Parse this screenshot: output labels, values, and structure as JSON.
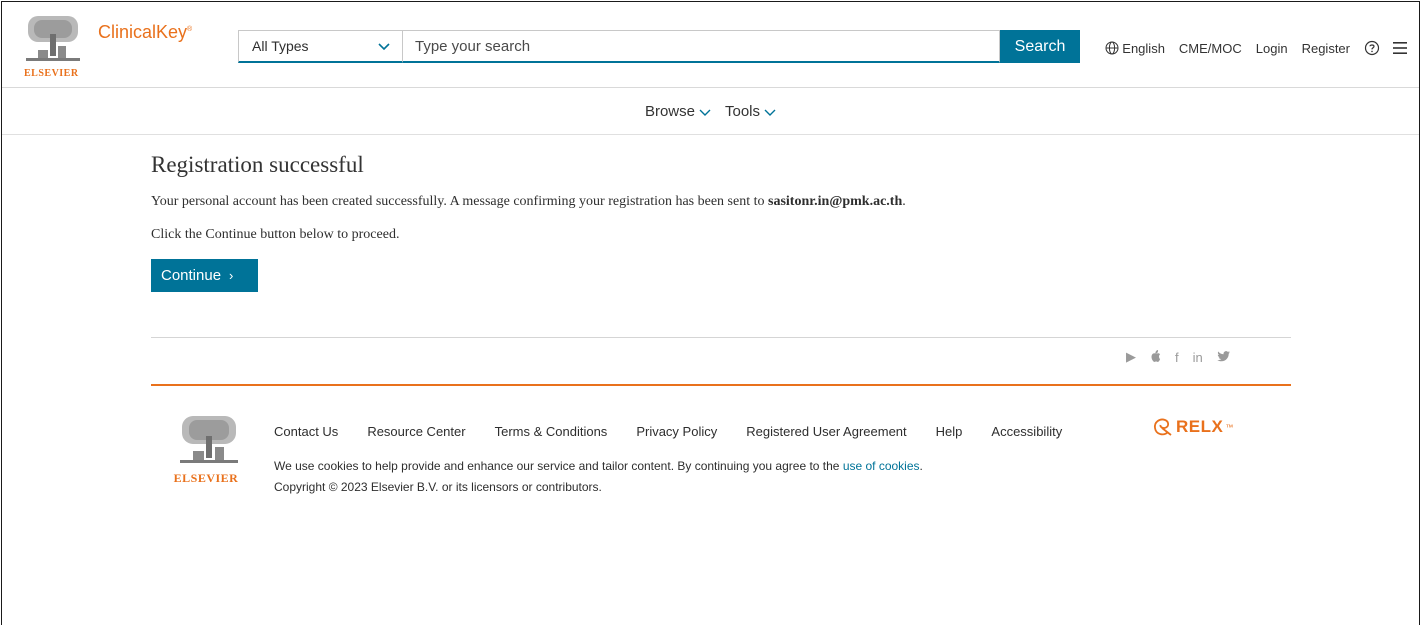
{
  "header": {
    "publisher": "ELSEVIER",
    "brand": "ClinicalKey",
    "brand_mark": "®",
    "type_select": "All Types",
    "search_placeholder": "Type your search",
    "search_button": "Search",
    "language": "English",
    "links": [
      "CME/MOC",
      "Login",
      "Register"
    ],
    "icons": [
      "globe-icon",
      "help-circle-icon",
      "hamburger-menu-icon"
    ]
  },
  "subnav": {
    "items": [
      "Browse",
      "Tools"
    ]
  },
  "main": {
    "title": "Registration successful",
    "message_prefix": "Your personal account has been created successfully. A message confirming your registration has been sent to ",
    "email": "sasitonr.in@pmk.ac.th",
    "message_suffix": ".",
    "instruction": "Click the Continue button below to proceed.",
    "continue_button": "Continue",
    "continue_arrow": "›"
  },
  "social": {
    "icons": [
      "play-icon",
      "apple-icon",
      "facebook-icon",
      "linkedin-icon",
      "twitter-icon"
    ],
    "glyphs": [
      "▶",
      "",
      "f",
      "in",
      "🐦"
    ]
  },
  "footer": {
    "publisher": "ELSEVIER",
    "links": [
      "Contact Us",
      "Resource Center",
      "Terms & Conditions",
      "Privacy Policy",
      "Registered User Agreement",
      "Help",
      "Accessibility"
    ],
    "cookie_text": "We use cookies to help provide and enhance our service and tailor content. By continuing you agree to the ",
    "cookie_link": "use of cookies",
    "cookie_end": ".",
    "copyright": "Copyright © 2023 Elsevier B.V. or its licensors or contributors.",
    "relx": "RELX",
    "relx_tm": "™"
  },
  "colors": {
    "accent": "#007398",
    "brand": "#e9711c"
  }
}
